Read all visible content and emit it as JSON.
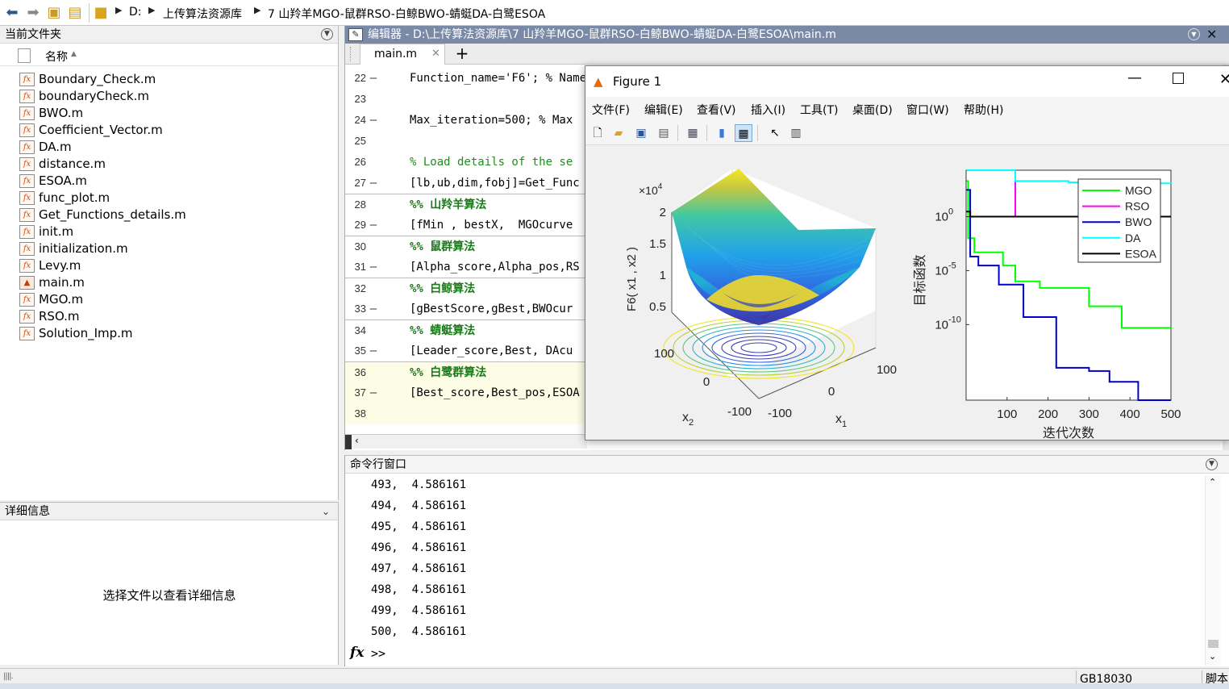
{
  "address": {
    "drive": "D:",
    "folder1": "上传算法资源库",
    "folder2": "7 山羚羊MGO-鼠群RSO-白鲸BWO-蜻蜓DA-白鹭ESOA"
  },
  "file_panel": {
    "title": "当前文件夹",
    "column_name": "名称",
    "files": [
      "Boundary_Check.m",
      "boundaryCheck.m",
      "BWO.m",
      "Coefficient_Vector.m",
      "DA.m",
      "distance.m",
      "ESOA.m",
      "func_plot.m",
      "Get_Functions_details.m",
      "init.m",
      "initialization.m",
      "Levy.m",
      "main.m",
      "MGO.m",
      "RSO.m",
      "Solution_Imp.m"
    ]
  },
  "details_panel": {
    "title": "详细信息",
    "hint": "选择文件以查看详细信息"
  },
  "editor": {
    "title": "编辑器 - D:\\上传算法资源库\\7 山羚羊MGO-鼠群RSO-白鲸BWO-蜻蜓DA-白鹭ESOA\\main.m",
    "tab": "main.m",
    "lines": [
      {
        "n": "22",
        "dash": "—",
        "code": "Function_name='F6'; % Name"
      },
      {
        "n": "23",
        "dash": "",
        "code": ""
      },
      {
        "n": "24",
        "dash": "—",
        "code": "Max_iteration=500; % Max"
      },
      {
        "n": "25",
        "dash": "",
        "code": ""
      },
      {
        "n": "26",
        "dash": "",
        "code": "% Load details of the se"
      },
      {
        "n": "27",
        "dash": "—",
        "code": "[lb,ub,dim,fobj]=Get_Func"
      },
      {
        "n": "28",
        "dash": "",
        "code": "%% 山羚羊算法"
      },
      {
        "n": "29",
        "dash": "—",
        "code": "[fMin , bestX,  MGOcurve"
      },
      {
        "n": "30",
        "dash": "",
        "code": "%% 鼠群算法"
      },
      {
        "n": "31",
        "dash": "—",
        "code": "[Alpha_score,Alpha_pos,RS"
      },
      {
        "n": "32",
        "dash": "",
        "code": "%% 白鲸算法"
      },
      {
        "n": "33",
        "dash": "—",
        "code": "[gBestScore,gBest,BWOcur"
      },
      {
        "n": "34",
        "dash": "",
        "code": "%% 蜻蜓算法"
      },
      {
        "n": "35",
        "dash": "—",
        "code": "[Leader_score,Best, DAcu"
      },
      {
        "n": "36",
        "dash": "",
        "code": "%% 白鹭群算法"
      },
      {
        "n": "37",
        "dash": "—",
        "code": "[Best_score,Best_pos,ESOA"
      },
      {
        "n": "38",
        "dash": "",
        "code": ""
      }
    ]
  },
  "command_window": {
    "title": "命令行窗口",
    "output": [
      "493,  4.586161",
      "494,  4.586161",
      "495,  4.586161",
      "496,  4.586161",
      "497,  4.586161",
      "498,  4.586161",
      "499,  4.586161",
      "500,  4.586161"
    ],
    "prompt": ">>",
    "fx": "fx"
  },
  "status_bar": {
    "encoding": "GB18030",
    "mode": "脚本"
  },
  "figure": {
    "title": "Figure 1",
    "menus": [
      "文件(F)",
      "编辑(E)",
      "查看(V)",
      "插入(I)",
      "工具(T)",
      "桌面(D)",
      "窗口(W)",
      "帮助(H)"
    ]
  },
  "chart_data": [
    {
      "type": "surface",
      "function": "F6",
      "zlabel": "F6( x1 , x2 )",
      "xlabel": "x1",
      "ylabel": "x2",
      "z_multiplier": "×10^4",
      "zticks": [
        "0.5",
        "1",
        "1.5",
        "2"
      ],
      "xticks": [
        "-100",
        "0",
        "100"
      ],
      "yticks": [
        "-100",
        "0",
        "100"
      ],
      "x_range": [
        -100,
        100
      ],
      "y_range": [
        -100,
        100
      ],
      "z_range": [
        0,
        20000
      ]
    },
    {
      "type": "line",
      "y_scale": "log",
      "xlabel": "迭代次数",
      "ylabel": "目标函数",
      "xlim": [
        0,
        500
      ],
      "xticks": [
        "100",
        "200",
        "300",
        "400",
        "500"
      ],
      "ytick_labels": [
        {
          "base": "10",
          "exp": "0"
        },
        {
          "base": "10",
          "exp": "-5"
        },
        {
          "base": "10",
          "exp": "-10"
        }
      ],
      "legend_position": "top-right",
      "series": [
        {
          "name": "MGO",
          "color": "#00ff00",
          "points": [
            [
              1,
              2000
            ],
            [
              5,
              0.01
            ],
            [
              20,
              0.0005
            ],
            [
              90,
              3e-05
            ],
            [
              120,
              1e-06
            ],
            [
              180,
              2.5e-07
            ],
            [
              300,
              5e-09
            ],
            [
              380,
              5e-11
            ],
            [
              500,
              4e-11
            ]
          ]
        },
        {
          "name": "RSO",
          "color": "#ff00ff",
          "points": [
            [
              1,
              20000
            ],
            [
              110,
              20000
            ],
            [
              120,
              1.0
            ],
            [
              500,
              1.0
            ]
          ]
        },
        {
          "name": "BWO",
          "color": "#0000cc",
          "points": [
            [
              1,
              300
            ],
            [
              10,
              0.0002
            ],
            [
              30,
              3e-05
            ],
            [
              80,
              5e-07
            ],
            [
              140,
              5e-10
            ],
            [
              220,
              1e-14
            ],
            [
              300,
              5e-15
            ],
            [
              350,
              5e-16
            ],
            [
              420,
              1e-17
            ],
            [
              500,
              1e-17
            ]
          ]
        },
        {
          "name": "DA",
          "color": "#00ffff",
          "points": [
            [
              1,
              20000
            ],
            [
              100,
              20000
            ],
            [
              120,
              2000
            ],
            [
              250,
              1500
            ],
            [
              400,
              1200
            ],
            [
              500,
              1100
            ]
          ]
        },
        {
          "name": "ESOA",
          "color": "#000000",
          "points": [
            [
              1,
              3
            ],
            [
              10,
              1.0
            ],
            [
              500,
              1.0
            ]
          ]
        }
      ]
    }
  ]
}
